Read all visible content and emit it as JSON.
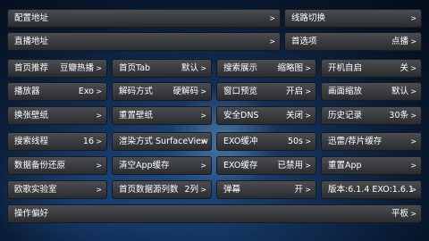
{
  "top_rows": [
    [
      {
        "label": "配置地址",
        "value": ""
      },
      {
        "label": "线路切换",
        "value": ""
      }
    ],
    [
      {
        "label": "直播地址",
        "value": ""
      },
      {
        "label": "首选项",
        "value": "点播"
      }
    ]
  ],
  "grid": [
    [
      {
        "label": "首页推荐",
        "value": "豆瓣热播"
      },
      {
        "label": "首页Tab",
        "value": "默认"
      },
      {
        "label": "搜索展示",
        "value": "缩略图"
      },
      {
        "label": "开机自启",
        "value": "关"
      }
    ],
    [
      {
        "label": "播放器",
        "value": "Exo"
      },
      {
        "label": "解码方式",
        "value": "硬解码"
      },
      {
        "label": "窗口预览",
        "value": "开启"
      },
      {
        "label": "画面缩放",
        "value": "默认"
      }
    ],
    [
      {
        "label": "换张壁纸",
        "value": ""
      },
      {
        "label": "重置壁纸",
        "value": ""
      },
      {
        "label": "安全DNS",
        "value": "关闭"
      },
      {
        "label": "历史记录",
        "value": "30条"
      }
    ],
    [
      {
        "label": "搜索线程",
        "value": "16"
      },
      {
        "label": "渲染方式 SurfaceView",
        "value": ""
      },
      {
        "label": "EXO缓冲",
        "value": "50s"
      },
      {
        "label": "迅雷/荐片缓存",
        "value": ""
      }
    ],
    [
      {
        "label": "数据备份还原",
        "value": ""
      },
      {
        "label": "清空App缓存",
        "value": ""
      },
      {
        "label": "EXO缓存",
        "value": "已禁用"
      },
      {
        "label": "重置App",
        "value": ""
      }
    ],
    [
      {
        "label": "欧歌实验室",
        "value": ""
      },
      {
        "label": "首页数据源列数",
        "value": "2列"
      },
      {
        "label": "弹幕",
        "value": "开"
      },
      {
        "label": "版本:6.1.4 EXO:1.6.1",
        "value": ""
      }
    ]
  ],
  "bottom_row": {
    "label": "操作偏好",
    "value": "平板"
  },
  "arrow": ">"
}
